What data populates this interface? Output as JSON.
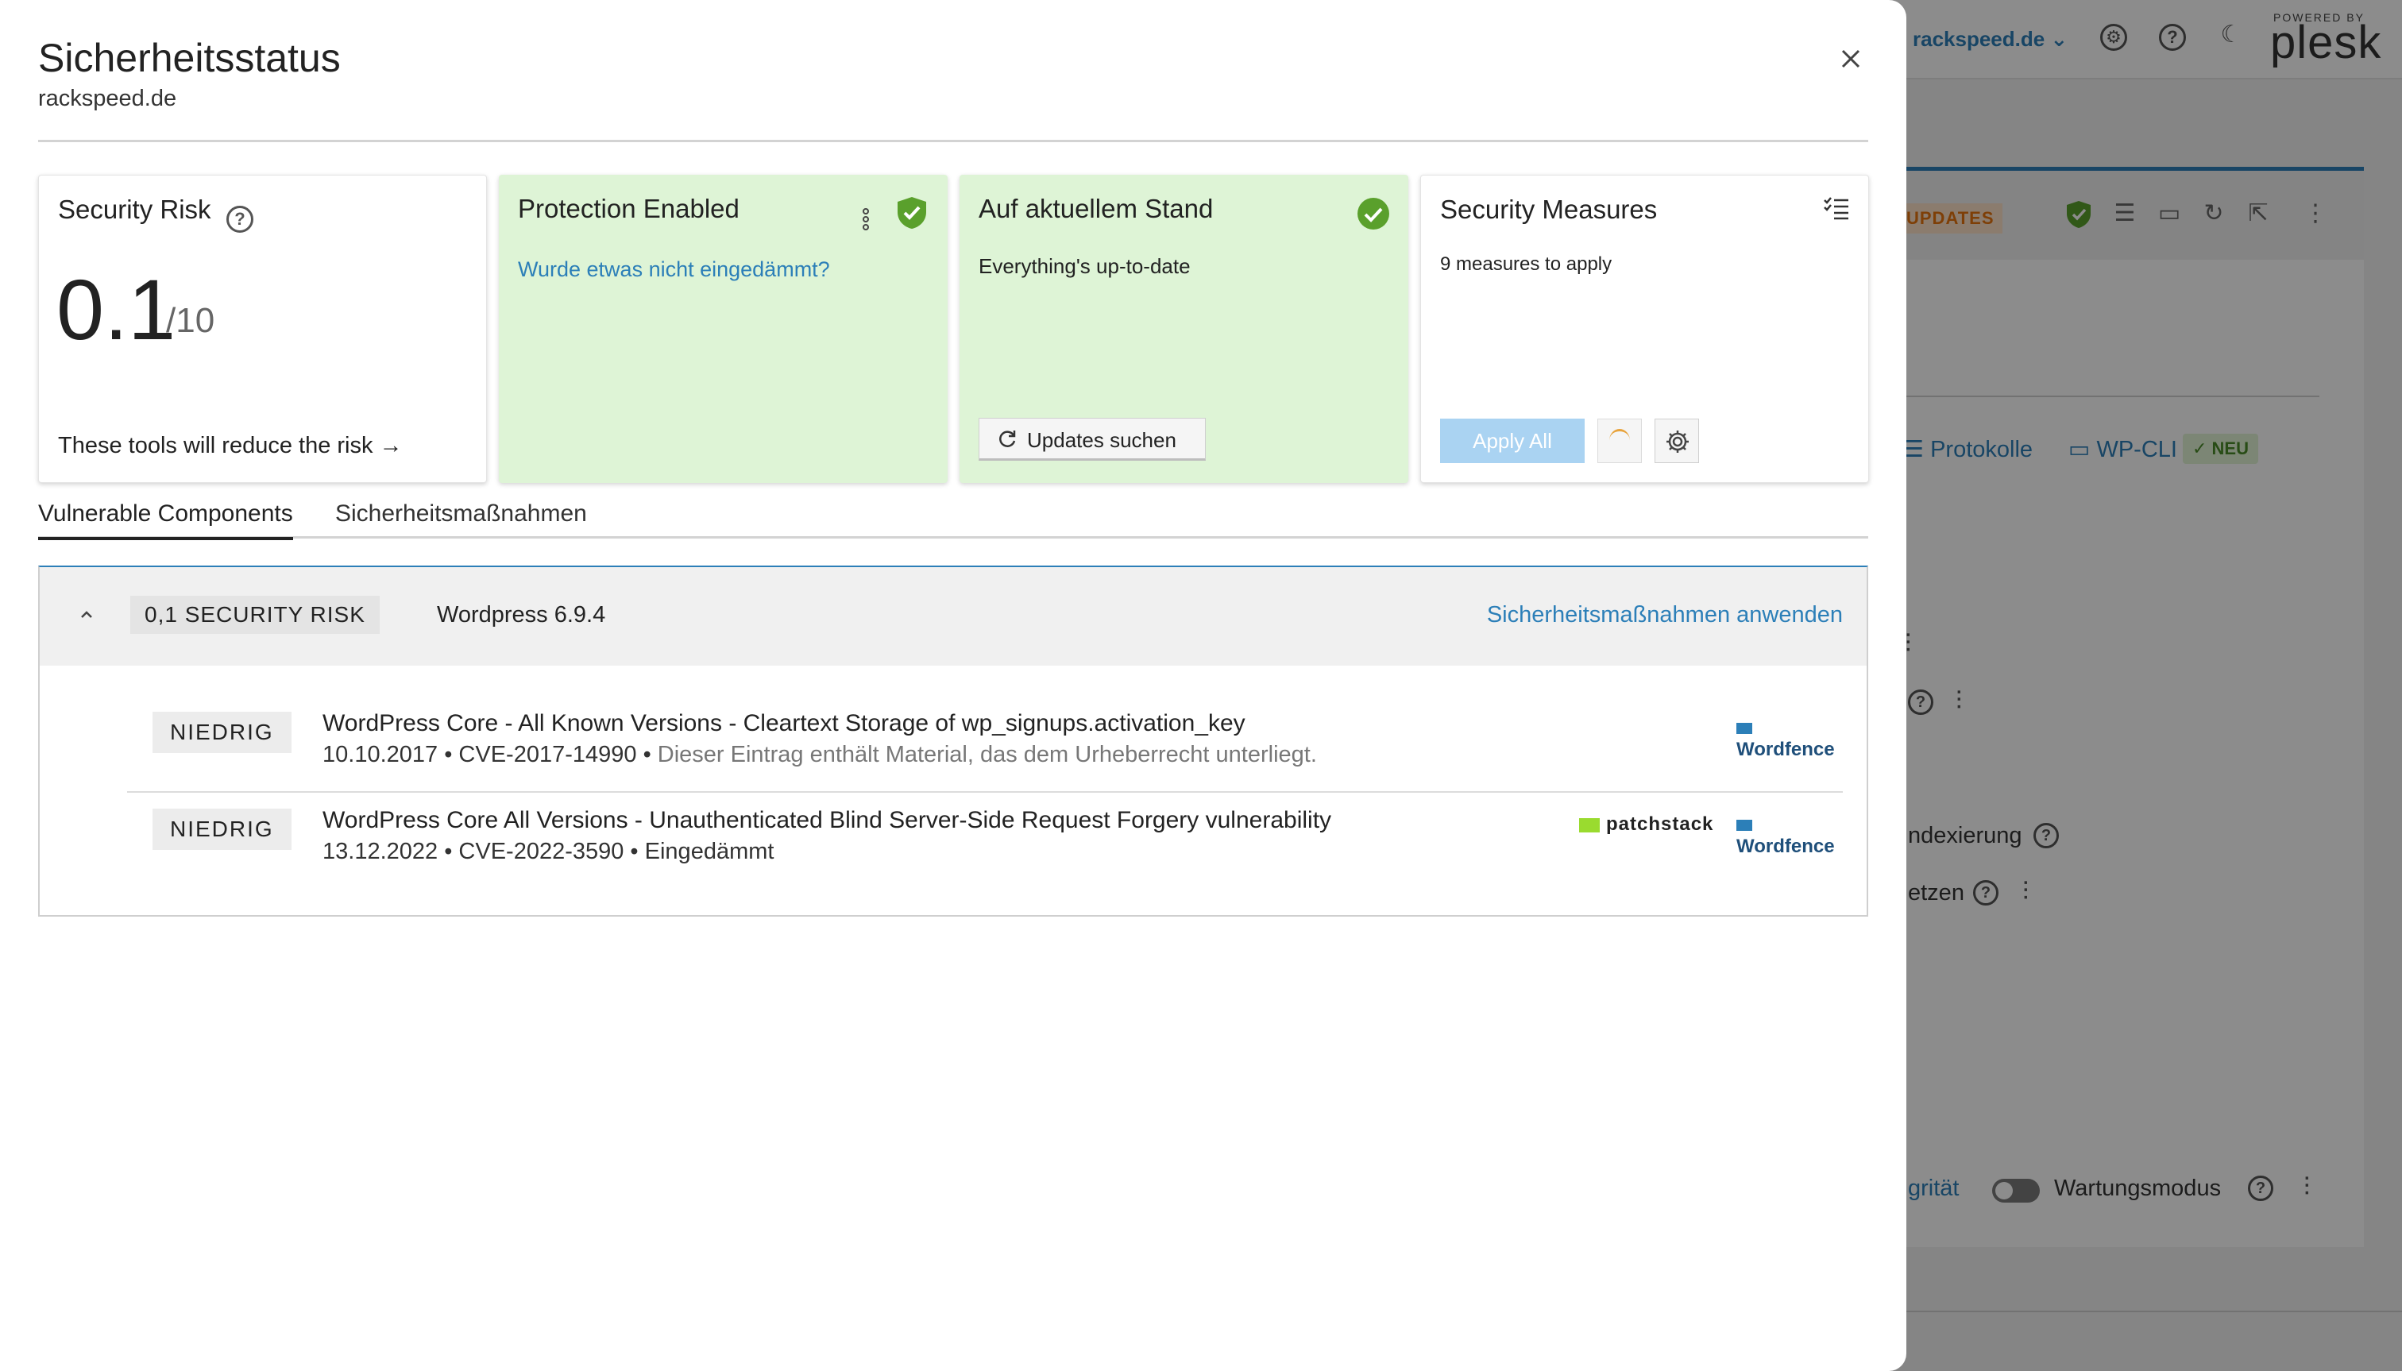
{
  "background": {
    "domain_selector": "rackspeed.de ⌄",
    "powered_by": "POWERED BY",
    "brand": "plesk",
    "updates_badge": "UPDATES",
    "protokolle": "Protokolle",
    "wp_cli": "WP-CLI",
    "neu_badge": "NEU",
    "indexierung_fragment": "ndexierung",
    "setzen_fragment": "etzen",
    "integritaet_fragment": "grität",
    "wartungsmodus": "Wartungsmodus"
  },
  "modal": {
    "title": "Sicherheitsstatus",
    "subtitle": "rackspeed.de",
    "close_icon": "close-icon"
  },
  "cards": {
    "risk": {
      "title": "Security Risk",
      "score": "0.1",
      "scale": "/10",
      "link": "These tools will reduce the risk →"
    },
    "protection": {
      "title": "Protection Enabled",
      "link": "Wurde etwas nicht eingedämmt?",
      "status_color": "#5aa02c"
    },
    "uptodate": {
      "title": "Auf aktuellem Stand",
      "text": "Everything's up-to-date",
      "button": "Updates suchen"
    },
    "measures": {
      "title": "Security Measures",
      "text": "9 measures to apply",
      "apply_button": "Apply All"
    }
  },
  "tabs": [
    {
      "label": "Vulnerable Components",
      "active": true
    },
    {
      "label": "Sicherheitsmaßnahmen",
      "active": false
    }
  ],
  "vulnerabilities": {
    "risk_badge": "0,1 SECURITY RISK",
    "component": "Wordpress 6.9.4",
    "apply_link": "Sicherheitsmaßnahmen anwenden",
    "items": [
      {
        "severity": "NIEDRIG",
        "title": "WordPress Core - All Known Versions - Cleartext Storage of wp_signups.activation_key",
        "meta": "10.10.2017 • CVE-2017-14990 •",
        "note": "Dieser Eintrag enthält Material, das dem Urheberrecht unterliegt.",
        "sources": [
          "Wordfence"
        ]
      },
      {
        "severity": "NIEDRIG",
        "title": "WordPress Core All Versions - Unauthenticated Blind Server-Side Request Forgery vulnerability",
        "meta": "13.12.2022 • CVE-2022-3590 • Eingedämmt",
        "note": "",
        "sources": [
          "patchstack",
          "Wordfence"
        ]
      }
    ]
  },
  "colors": {
    "accent": "#2c7fb8",
    "success": "#5aa02c",
    "success_bg": "#def4d6"
  }
}
